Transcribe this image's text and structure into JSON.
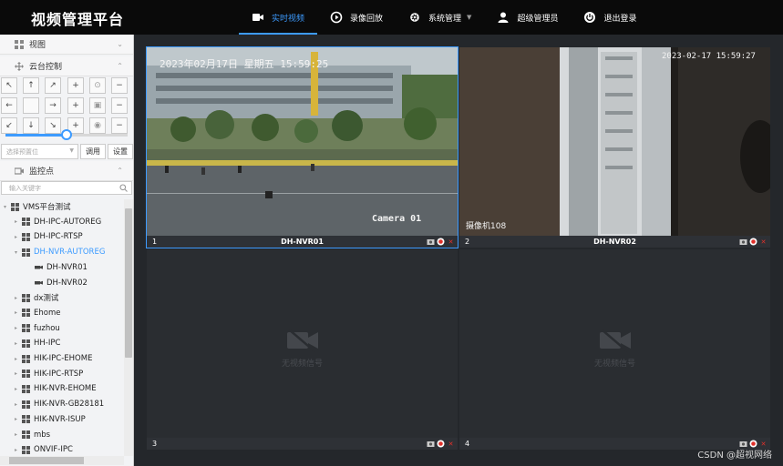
{
  "app": {
    "title": "视频管理平台"
  },
  "nav": [
    {
      "label": "实时视频",
      "icon": "video-camera-icon",
      "active": true
    },
    {
      "label": "录像回放",
      "icon": "playback-icon",
      "active": false
    },
    {
      "label": "系统管理",
      "icon": "gear-icon",
      "active": false,
      "dropdown": true
    },
    {
      "label": "超级管理员",
      "icon": "user-icon",
      "active": false
    },
    {
      "label": "退出登录",
      "icon": "power-icon",
      "active": false
    }
  ],
  "sidebar": {
    "view_label": "视图",
    "ptz_label": "云台控制",
    "ptz_speed": 0.5,
    "preset_placeholder": "选择预置位",
    "call_label": "调用",
    "set_label": "设置",
    "monitor_label": "监控点",
    "search_placeholder": "输入关键字",
    "tree": [
      {
        "label": "VMS平台测试",
        "level": 0,
        "expanded": true
      },
      {
        "label": "DH-IPC-AUTOREG",
        "level": 1
      },
      {
        "label": "DH-IPC-RTSP",
        "level": 1
      },
      {
        "label": "DH-NVR-AUTOREG",
        "level": 1,
        "expanded": true,
        "selected": true
      },
      {
        "label": "DH-NVR01",
        "level": 2,
        "camera": true
      },
      {
        "label": "DH-NVR02",
        "level": 2,
        "camera": true
      },
      {
        "label": "dx测试",
        "level": 1
      },
      {
        "label": "Ehome",
        "level": 1
      },
      {
        "label": "fuzhou",
        "level": 1
      },
      {
        "label": "HH-IPC",
        "level": 1
      },
      {
        "label": "HIK-IPC-EHOME",
        "level": 1
      },
      {
        "label": "HIK-IPC-RTSP",
        "level": 1
      },
      {
        "label": "HIK-NVR-EHOME",
        "level": 1
      },
      {
        "label": "HIK-NVR-GB28181",
        "level": 1
      },
      {
        "label": "HIK-NVR-ISUP",
        "level": 1
      },
      {
        "label": "mbs",
        "level": 1
      },
      {
        "label": "ONVIF-IPC",
        "level": 1
      }
    ]
  },
  "panes": [
    {
      "num": "1",
      "name": "DH-NVR01",
      "active": true,
      "osd_time": "2023年02月17日 星期五 15:59:25",
      "osd_label": "Camera 01"
    },
    {
      "num": "2",
      "name": "DH-NVR02",
      "active": false,
      "osd_time": "2023-02-17 15:59:27",
      "osd_label": "摄像机108"
    },
    {
      "num": "3",
      "name": "",
      "active": false,
      "no_signal": "无视频信号"
    },
    {
      "num": "4",
      "name": "",
      "active": false,
      "no_signal": "无视频信号"
    }
  ],
  "watermark": "CSDN @超视网络",
  "colors": {
    "accent": "#3d9bff",
    "topbar": "#0a0a0a",
    "grid_bg": "#24272b",
    "close_red": "#e0302a"
  }
}
